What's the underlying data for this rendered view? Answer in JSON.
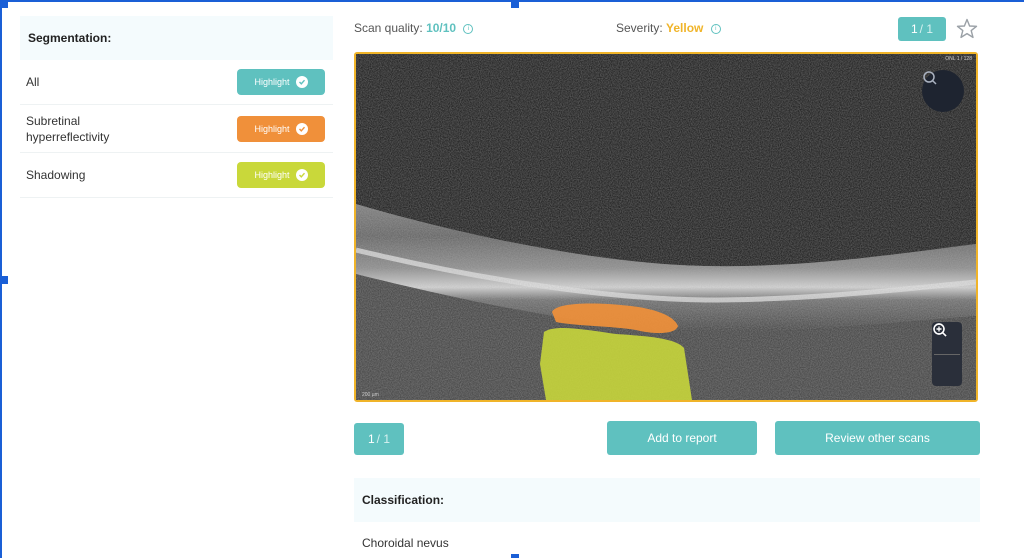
{
  "segmentation": {
    "title": "Segmentation:",
    "items": [
      {
        "label": "All",
        "button_label": "Highlight",
        "color": "#5fc1bf"
      },
      {
        "label": "Subretinal hyperreflectivity",
        "button_label": "Highlight",
        "color": "#f0903a"
      },
      {
        "label": "Shadowing",
        "button_label": "Highlight",
        "color": "#c9d83a"
      }
    ]
  },
  "header": {
    "scan_quality_label": "Scan quality:",
    "scan_quality_value": "10/10",
    "severity_label": "Severity:",
    "severity_value": "Yellow",
    "severity_color": "#f0b429",
    "accent_color": "#5fc1bf"
  },
  "pager_top": {
    "current": "1",
    "total": "/ 1"
  },
  "pager_bottom": {
    "current": "1",
    "total": "/ 1"
  },
  "actions": {
    "add_to_report": "Add to report",
    "review_other_scans": "Review other scans"
  },
  "viewer": {
    "scale_label": "200 µm",
    "corner_label": "ONL 1 / 128"
  },
  "classification": {
    "title": "Classification:",
    "value": "Choroidal nevus"
  },
  "icons": [
    "info-icon",
    "star-icon",
    "search-icon",
    "zoom-in-icon",
    "zoom-out-icon",
    "check-icon"
  ]
}
